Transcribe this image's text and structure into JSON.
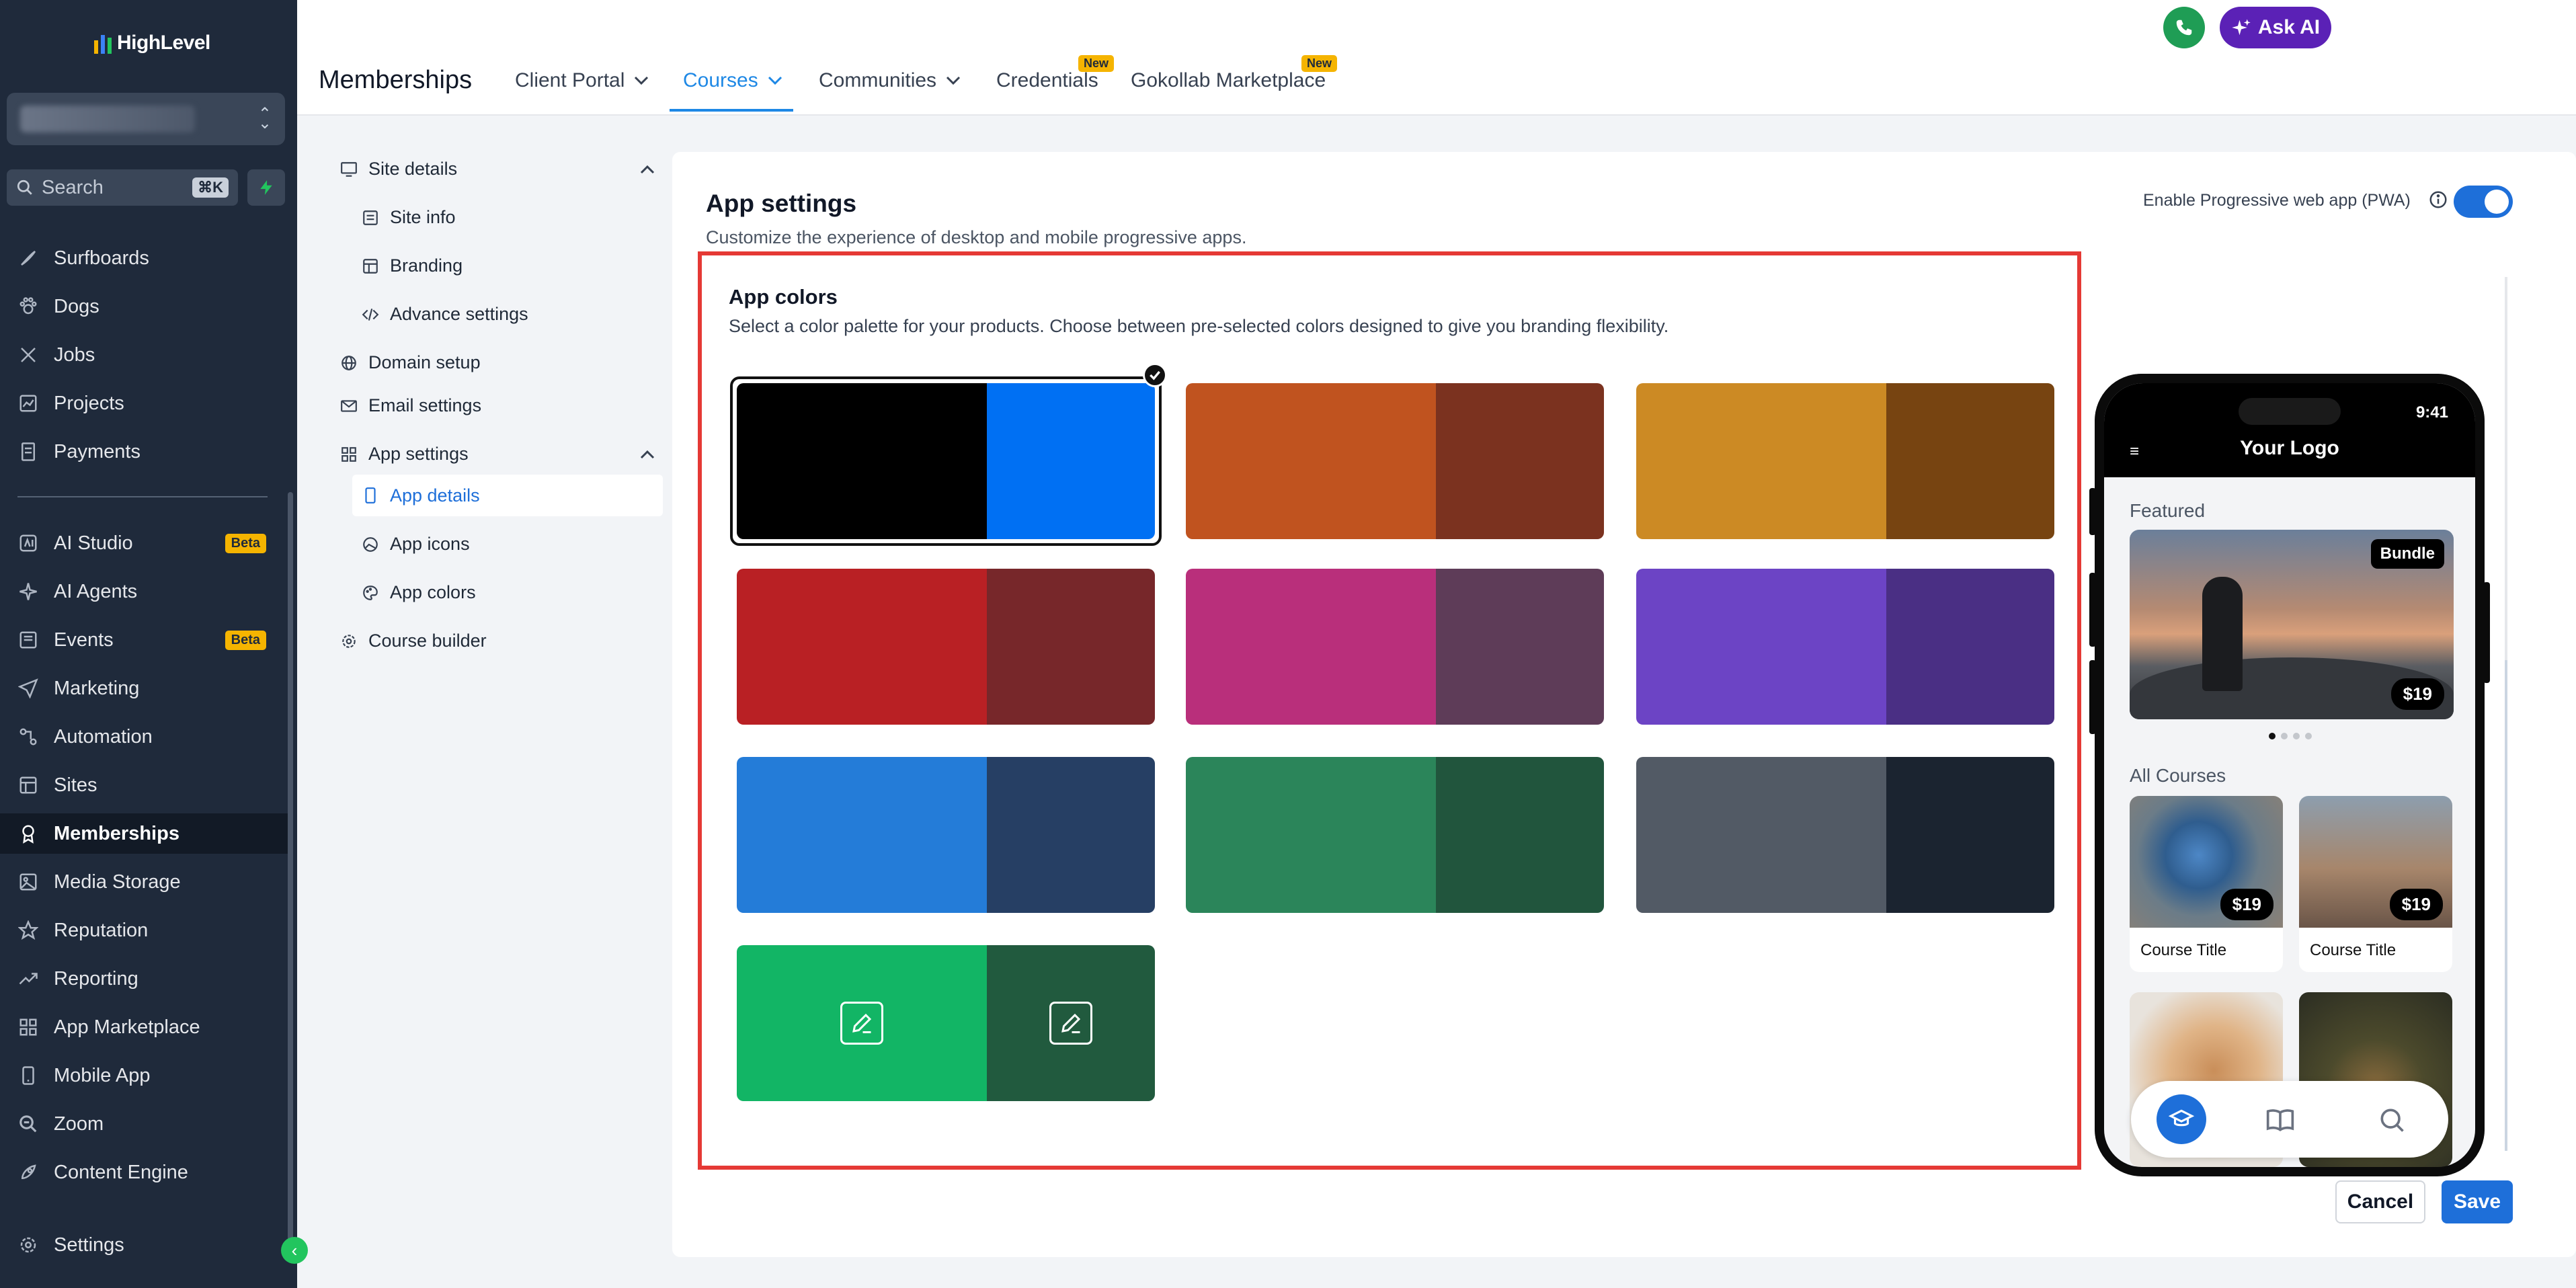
{
  "brand": {
    "logo": "HighLevel"
  },
  "sidebar": {
    "search_placeholder": "Search",
    "search_shortcut": "⌘K",
    "items": [
      {
        "label": "Surfboards",
        "icon": "paint-icon"
      },
      {
        "label": "Dogs",
        "icon": "paw-icon"
      },
      {
        "label": "Jobs",
        "icon": "tools-icon"
      },
      {
        "label": "Projects",
        "icon": "chart-icon"
      },
      {
        "label": "Payments",
        "icon": "receipt-icon"
      },
      {
        "label": "AI Studio",
        "icon": "ai-studio-icon",
        "badge": "Beta"
      },
      {
        "label": "AI Agents",
        "icon": "sparkle-icon"
      },
      {
        "label": "Events",
        "icon": "events-icon",
        "badge": "Beta"
      },
      {
        "label": "Marketing",
        "icon": "send-icon"
      },
      {
        "label": "Automation",
        "icon": "automation-icon"
      },
      {
        "label": "Sites",
        "icon": "sites-icon"
      },
      {
        "label": "Memberships",
        "icon": "award-icon",
        "active": true
      },
      {
        "label": "Media Storage",
        "icon": "image-icon"
      },
      {
        "label": "Reputation",
        "icon": "star-icon"
      },
      {
        "label": "Reporting",
        "icon": "trend-icon"
      },
      {
        "label": "App Marketplace",
        "icon": "grid-icon"
      },
      {
        "label": "Mobile App",
        "icon": "mobile-icon"
      },
      {
        "label": "Zoom",
        "icon": "zoom-icon"
      },
      {
        "label": "Content Engine",
        "icon": "rocket-icon"
      }
    ],
    "settings": "Settings"
  },
  "header": {
    "title": "Memberships",
    "tabs": [
      {
        "label": "Client Portal",
        "dropdown": true
      },
      {
        "label": "Courses",
        "dropdown": true,
        "active": true
      },
      {
        "label": "Communities",
        "dropdown": true
      },
      {
        "label": "Credentials",
        "badge": "New"
      },
      {
        "label": "Gokollab Marketplace",
        "badge": "New"
      }
    ],
    "ask_ai": "Ask AI",
    "help": "?"
  },
  "subnav": {
    "site_details": "Site details",
    "site_info": "Site info",
    "branding": "Branding",
    "advance_settings": "Advance settings",
    "domain_setup": "Domain setup",
    "email_settings": "Email settings",
    "app_settings": "App settings",
    "app_details": "App details",
    "app_icons": "App icons",
    "app_colors": "App colors",
    "course_builder": "Course builder"
  },
  "panel": {
    "title": "App settings",
    "subtitle": "Customize the experience of desktop and mobile progressive apps.",
    "pwa_label": "Enable Progressive web app (PWA)",
    "pwa_enabled": true,
    "colors_title": "App colors",
    "colors_subtitle": "Select a color palette for your products. Choose between pre-selected colors designed to give you branding flexibility.",
    "palettes": [
      {
        "primary": "#000000",
        "secondary": "#0070f3",
        "selected": true
      },
      {
        "primary": "#c0531f",
        "secondary": "#7b321f"
      },
      {
        "primary": "#cc8a24",
        "secondary": "#774411"
      },
      {
        "primary": "#b92024",
        "secondary": "#77272a"
      },
      {
        "primary": "#b92f7b",
        "secondary": "#5e3c58"
      },
      {
        "primary": "#6c44c5",
        "secondary": "#4a2f84"
      },
      {
        "primary": "#247cd8",
        "secondary": "#263f64"
      },
      {
        "primary": "#2b855a",
        "secondary": "#21553d"
      },
      {
        "primary": "#525a65",
        "secondary": "#1b2430"
      },
      {
        "primary": "#12b565",
        "secondary": "#215a3e",
        "custom": true
      }
    ],
    "cancel": "Cancel",
    "save": "Save"
  },
  "preview": {
    "time": "9:41",
    "logo": "Your Logo",
    "featured": "Featured",
    "featured_badge": "Bundle",
    "featured_price": "$19",
    "all_courses": "All Courses",
    "courses": [
      {
        "title": "Course Title",
        "price": "$19"
      },
      {
        "title": "Course Title",
        "price": "$19"
      }
    ]
  }
}
